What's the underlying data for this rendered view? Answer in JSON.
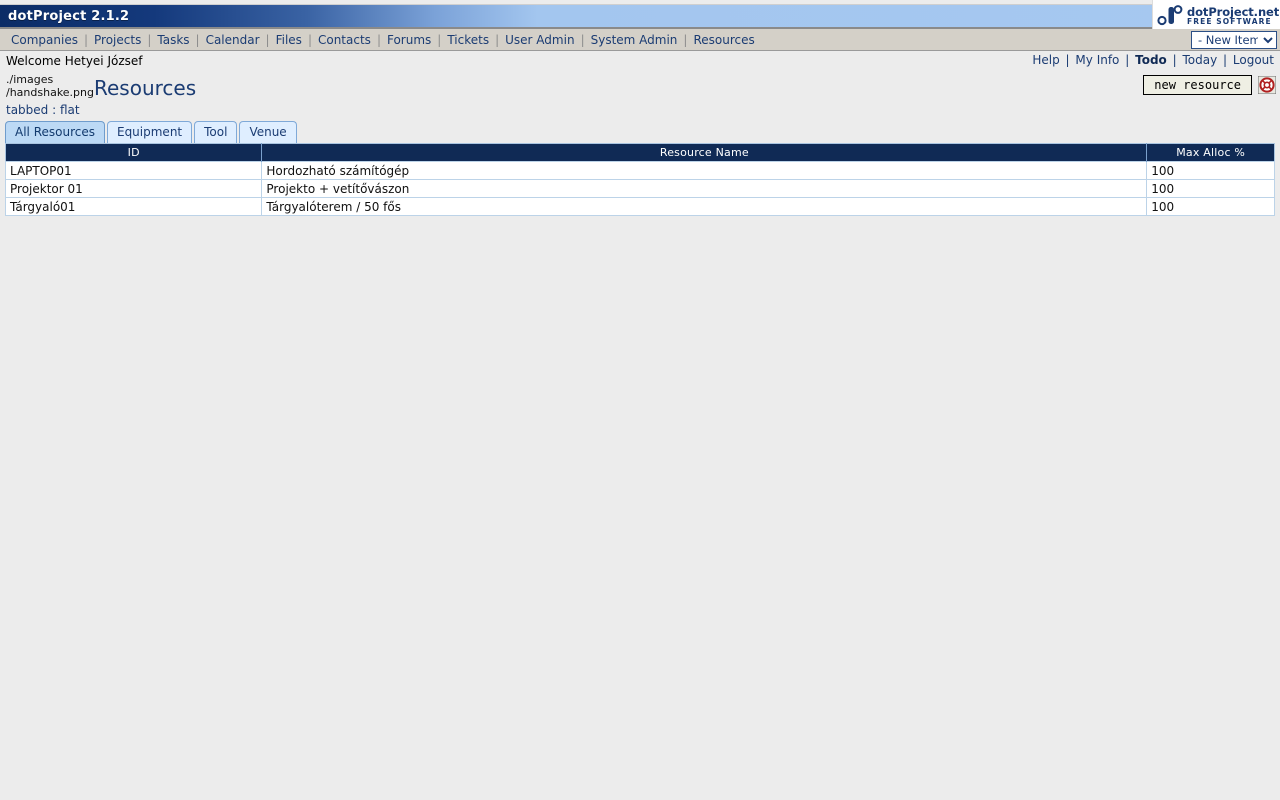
{
  "titlebar": {
    "app_title": "dotProject 2.1.2",
    "brand_name": "dotProject.net",
    "brand_sub": "FREE SOFTWARE",
    "gradient_start": "#0b2c66",
    "gradient_end": "#a6c8f0"
  },
  "nav": {
    "items": [
      {
        "label": "Companies"
      },
      {
        "label": "Projects"
      },
      {
        "label": "Tasks"
      },
      {
        "label": "Calendar"
      },
      {
        "label": "Files"
      },
      {
        "label": "Contacts"
      },
      {
        "label": "Forums"
      },
      {
        "label": "Tickets"
      },
      {
        "label": "User Admin"
      },
      {
        "label": "System Admin"
      },
      {
        "label": "Resources"
      }
    ],
    "separator": "|",
    "new_item_select": {
      "selected": "- New Item -",
      "options": [
        "- New Item -"
      ]
    }
  },
  "welcome": {
    "text": "Welcome Hetyei József",
    "links": [
      {
        "label": "Help",
        "strong": false
      },
      {
        "label": "My Info",
        "strong": false
      },
      {
        "label": "Todo",
        "strong": true
      },
      {
        "label": "Today",
        "strong": false
      },
      {
        "label": "Logout",
        "strong": false
      }
    ],
    "separator": "|"
  },
  "page": {
    "broken_image_alt": "./images\n/handshake.png",
    "title": "Resources",
    "subtitle": "tabbed : flat",
    "new_resource_button": "new resource",
    "help_icon_name": "lifebuoy-icon"
  },
  "tabs": [
    {
      "label": "All Resources",
      "active": true
    },
    {
      "label": "Equipment",
      "active": false
    },
    {
      "label": "Tool",
      "active": false
    },
    {
      "label": "Venue",
      "active": false
    }
  ],
  "table": {
    "columns": [
      "ID",
      "Resource Name",
      "Max Alloc %"
    ],
    "rows": [
      {
        "id": "LAPTOP01",
        "name": "Hordozható számítógép",
        "alloc": "100"
      },
      {
        "id": "Projektor 01",
        "name": "Projekto + vetítővászon",
        "alloc": "100"
      },
      {
        "id": "Tárgyaló01",
        "name": "Tárgyalóterem / 50 fős",
        "alloc": "100"
      }
    ]
  },
  "colors": {
    "header_navy": "#102a55",
    "link_blue": "#1b3c73",
    "page_bg": "#ececec",
    "navbar_bg": "#d4d0c8",
    "tab_active_bg": "#bcd9f5",
    "tab_inactive_bg": "#dfeeff"
  }
}
